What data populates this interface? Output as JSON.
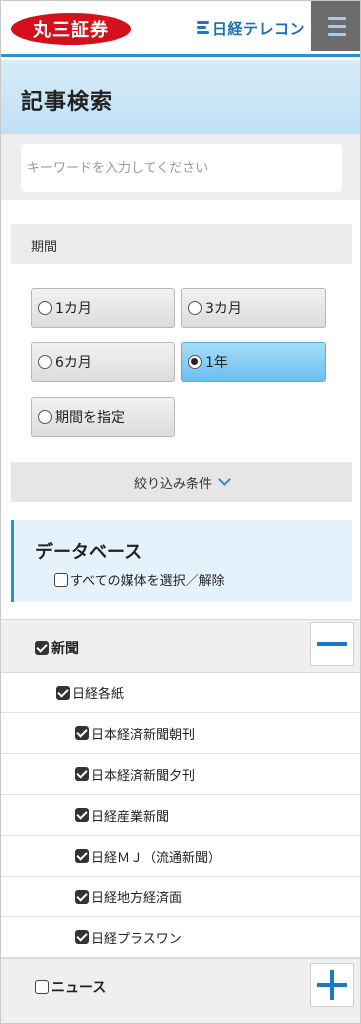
{
  "header": {
    "brand_name": "丸三証券",
    "service_name": "日経テレコン",
    "menu_icon": "hamburger-menu-icon",
    "accent_color": "#2b8fd6",
    "brand_color": "#d3101b"
  },
  "page": {
    "title": "記事検索"
  },
  "search": {
    "placeholder": "キーワードを入力してください",
    "value": ""
  },
  "period": {
    "label": "期間",
    "options": [
      {
        "label": "1カ月",
        "selected": false
      },
      {
        "label": "3カ月",
        "selected": false
      },
      {
        "label": "6カ月",
        "selected": false
      },
      {
        "label": "1年",
        "selected": true
      },
      {
        "label": "期間を指定",
        "selected": false
      }
    ]
  },
  "filter": {
    "label": "絞り込み条件",
    "icon": "chevron-down-icon"
  },
  "database": {
    "title": "データベース",
    "select_all_label": "すべての媒体を選択／解除",
    "select_all_checked": false
  },
  "categories": [
    {
      "label": "新聞",
      "checked": true,
      "expanded": true,
      "toggle_icon": "minus-icon",
      "groups": [
        {
          "label": "日経各紙",
          "checked": true,
          "items": [
            {
              "label": "日本経済新聞朝刊",
              "checked": true
            },
            {
              "label": "日本経済新聞夕刊",
              "checked": true
            },
            {
              "label": "日経産業新聞",
              "checked": true
            },
            {
              "label": "日経ＭＪ（流通新聞）",
              "checked": true
            },
            {
              "label": "日経地方経済面",
              "checked": true
            },
            {
              "label": "日経プラスワン",
              "checked": true
            }
          ]
        }
      ]
    },
    {
      "label": "ニュース",
      "checked": false,
      "expanded": false,
      "toggle_icon": "plus-icon"
    }
  ]
}
